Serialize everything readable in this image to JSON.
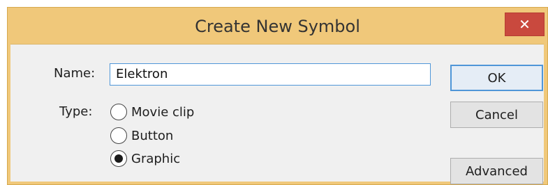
{
  "dialog": {
    "title": "Create New Symbol",
    "close_label": "✕"
  },
  "form": {
    "name_label": "Name:",
    "name_value": "Elektron",
    "type_label": "Type:",
    "type_options": [
      {
        "label": "Movie clip",
        "selected": false
      },
      {
        "label": "Button",
        "selected": false
      },
      {
        "label": "Graphic",
        "selected": true
      }
    ]
  },
  "buttons": {
    "ok": "OK",
    "cancel": "Cancel",
    "advanced": "Advanced"
  },
  "colors": {
    "titlebar": "#f0c87a",
    "close_button": "#c9493e",
    "focus_border": "#4f96d8",
    "dialog_background": "#f0f0f0"
  }
}
